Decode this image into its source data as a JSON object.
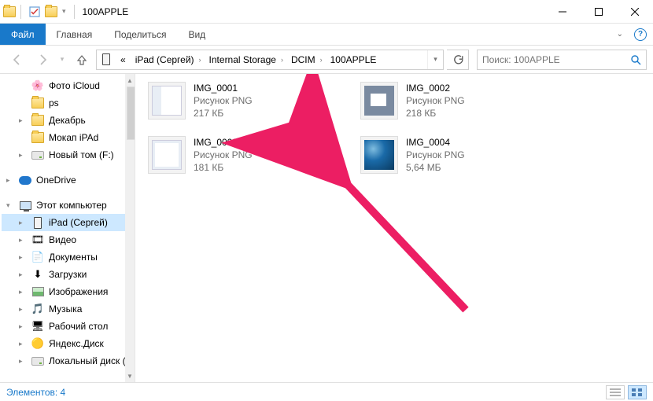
{
  "window": {
    "title": "100APPLE"
  },
  "ribbon": {
    "file": "Файл",
    "home": "Главная",
    "share": "Поделиться",
    "view": "Вид"
  },
  "breadcrumb": {
    "root_prefix": "«",
    "items": [
      "iPad (Сергей)",
      "Internal Storage",
      "DCIM",
      "100APPLE"
    ]
  },
  "search": {
    "placeholder": "Поиск: 100APPLE"
  },
  "tree": [
    {
      "label": "Фото iCloud",
      "icon": "photos",
      "level": 1
    },
    {
      "label": "ps",
      "icon": "folder",
      "level": 1
    },
    {
      "label": "Декабрь",
      "icon": "folder",
      "level": 1,
      "expander": "▸"
    },
    {
      "label": "Мокап iPAd",
      "icon": "folder",
      "level": 1
    },
    {
      "label": "Новый том (F:)",
      "icon": "drive",
      "level": 1,
      "expander": "▸"
    },
    {
      "sep": true
    },
    {
      "label": "OneDrive",
      "icon": "cloud",
      "level": 0,
      "expander": "▸"
    },
    {
      "sep": true
    },
    {
      "label": "Этот компьютер",
      "icon": "monitor",
      "level": 0,
      "expander": "▾"
    },
    {
      "label": "iPad (Сергей)",
      "icon": "device",
      "level": 1,
      "selected": true,
      "expander": "▸"
    },
    {
      "label": "Видео",
      "icon": "video",
      "level": 1,
      "expander": "▸"
    },
    {
      "label": "Документы",
      "icon": "docs",
      "level": 1,
      "expander": "▸"
    },
    {
      "label": "Загрузки",
      "icon": "downloads",
      "level": 1,
      "expander": "▸"
    },
    {
      "label": "Изображения",
      "icon": "image",
      "level": 1,
      "expander": "▸"
    },
    {
      "label": "Музыка",
      "icon": "music",
      "level": 1,
      "expander": "▸"
    },
    {
      "label": "Рабочий стол",
      "icon": "desktop",
      "level": 1,
      "expander": "▸"
    },
    {
      "label": "Яндекс.Диск",
      "icon": "yadisk",
      "level": 1,
      "expander": "▸"
    },
    {
      "label": "Локальный диск (",
      "icon": "drive",
      "level": 1,
      "expander": "▸"
    }
  ],
  "files": [
    {
      "name": "IMG_0001",
      "type": "Рисунок PNG",
      "size": "217 КБ",
      "thumb": "t1"
    },
    {
      "name": "IMG_0002",
      "type": "Рисунок PNG",
      "size": "218 КБ",
      "thumb": "t2"
    },
    {
      "name": "IMG_0003",
      "type": "Рисунок PNG",
      "size": "181 КБ",
      "thumb": "t3"
    },
    {
      "name": "IMG_0004",
      "type": "Рисунок PNG",
      "size": "5,64 МБ",
      "thumb": "t4"
    }
  ],
  "status": {
    "elements_label": "Элементов:",
    "count": "4"
  },
  "icons": {
    "photos": "🌸",
    "folder": "folder-shape",
    "drive": "drive-shape",
    "cloud": "cloud-shape",
    "monitor": "monitor-shape",
    "device": "device-shape",
    "video": "🎞",
    "docs": "📄",
    "downloads": "⬇",
    "image": "image-shape",
    "music": "🎵",
    "desktop": "🖥",
    "yadisk": "🟡"
  }
}
